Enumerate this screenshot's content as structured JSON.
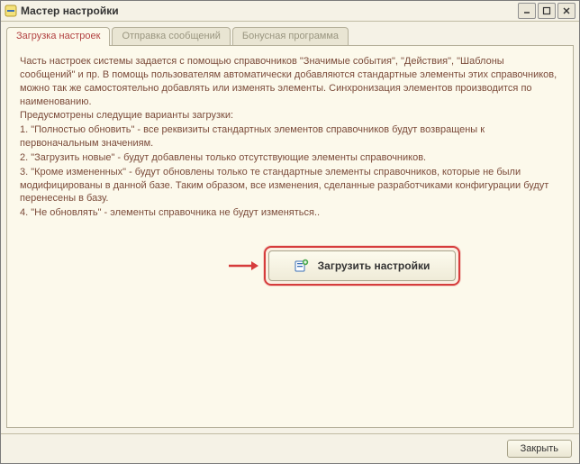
{
  "window": {
    "title": "Мастер настройки"
  },
  "tabs": [
    {
      "label": "Загрузка настроек"
    },
    {
      "label": "Отправка сообщений"
    },
    {
      "label": "Бонусная программа"
    }
  ],
  "body": {
    "paragraph1": "Часть настроек системы задается с помощью справочников \"Значимые события\", \"Действия\", \"Шаблоны сообщений\" и пр. В помощь пользователям автоматически добавляются стандартные элементы этих справочников, можно так же самостоятельно добавлять или изменять элементы. Синхронизация элементов производится по наименованию.",
    "paragraph2": "Предусмотрены следущие варианты загрузки:",
    "item1": "1. \"Полностью обновить\" - все реквизиты стандартных элементов справочников будут возвращены к первоначальным значениям.",
    "item2": "2. \"Загрузить новые\" - будут добавлены только отсутствующие элементы справочников.",
    "item3": "3. \"Кроме измененных\" - будут обновлены только те стандартные элементы справочников, которые не были модифицированы в данной базе. Таким образом, все изменения, сделанные разработчиками конфигурации будут перенесены в базу.",
    "item4": "4. \"Не обновлять\" - элементы справочника не будут изменяться.."
  },
  "buttons": {
    "load": "Загрузить настройки",
    "close": "Закрыть"
  },
  "colors": {
    "accent_red": "#d63c3c",
    "text_brown": "#7b4b3a"
  }
}
